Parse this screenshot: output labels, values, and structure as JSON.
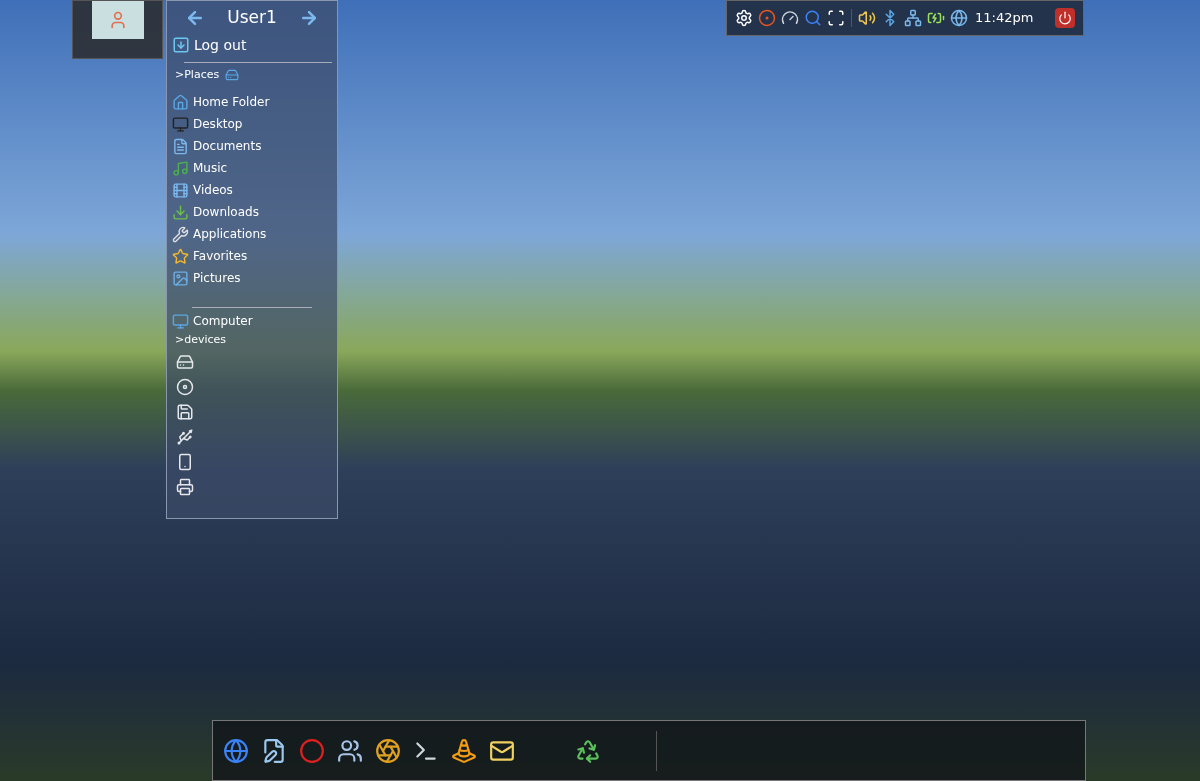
{
  "user_panel": {
    "title": "User1",
    "logout": "Log out",
    "places_heading": ">Places",
    "places": [
      {
        "label": "Home Folder"
      },
      {
        "label": "Desktop"
      },
      {
        "label": "Documents"
      },
      {
        "label": "Music"
      },
      {
        "label": "Videos"
      },
      {
        "label": "Downloads"
      },
      {
        "label": "Applications"
      },
      {
        "label": "Favorites"
      },
      {
        "label": "Pictures"
      }
    ],
    "computer": "Computer",
    "devices_heading": ">devices"
  },
  "tray": {
    "clock": "11:42pm"
  }
}
